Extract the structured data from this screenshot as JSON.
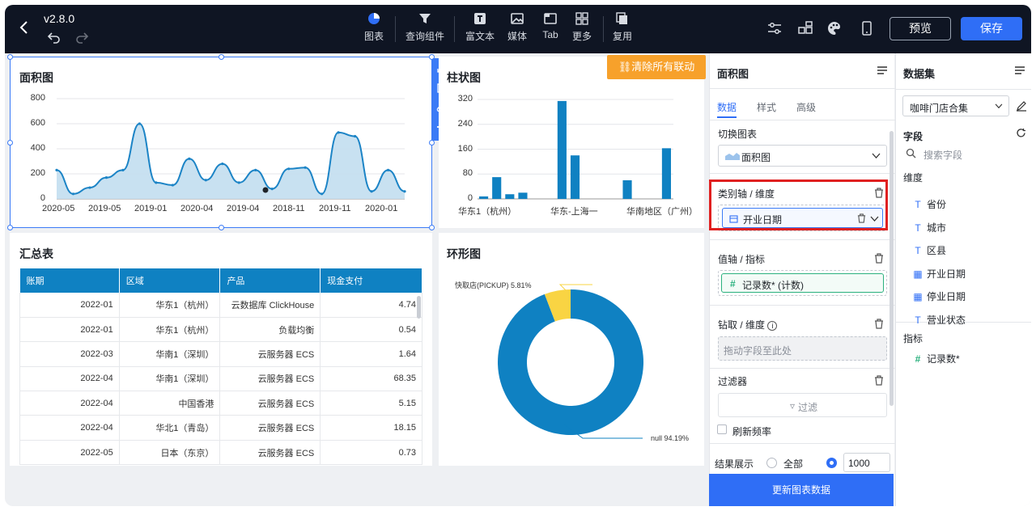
{
  "header": {
    "version": "v2.8.0",
    "tools": [
      {
        "label": "图表",
        "icon": "pie-chart-icon"
      },
      {
        "label": "查询组件",
        "icon": "filter-icon"
      },
      {
        "label": "富文本",
        "icon": "text-icon"
      },
      {
        "label": "媒体",
        "icon": "image-icon"
      },
      {
        "label": "Tab",
        "icon": "tab-icon"
      },
      {
        "label": "更多",
        "icon": "grid-icon"
      },
      {
        "label": "复用",
        "icon": "copy-icon"
      }
    ],
    "preview_label": "预览",
    "save_label": "保存"
  },
  "area_chart": {
    "title": "面积图",
    "chart_data": {
      "type": "area",
      "yticks": [
        "800",
        "600",
        "400",
        "200",
        "0"
      ],
      "xticks": [
        "2020-05",
        "2019-05",
        "2019-01",
        "2020-04",
        "2019-04",
        "2018-11",
        "2019-11",
        "2020-01"
      ],
      "ylim": [
        0,
        800
      ],
      "values": [
        230,
        40,
        90,
        170,
        230,
        600,
        130,
        110,
        320,
        150,
        280,
        130,
        230,
        80,
        240,
        250,
        40,
        530,
        500,
        60,
        230,
        60
      ],
      "color": "#1c84c6"
    }
  },
  "bar_chart": {
    "title": "柱状图",
    "chart_data": {
      "type": "bar",
      "yticks": [
        "320",
        "240",
        "160",
        "80",
        "0"
      ],
      "xticks": [
        "华东1（杭州）",
        "华东-上海一",
        "华南地区（广州）"
      ],
      "ylim": [
        0,
        320
      ],
      "values": [
        8,
        70,
        15,
        20,
        0,
        0,
        315,
        140,
        0,
        0,
        0,
        60,
        0,
        0,
        163
      ],
      "color": "#0f81c2"
    }
  },
  "clear_button_label": "清除所有联动",
  "table": {
    "title": "汇总表",
    "columns": [
      "账期",
      "区域",
      "产品",
      "现金支付"
    ],
    "rows": [
      [
        "2022-01",
        "华东1（杭州）",
        "云数据库 ClickHouse",
        "4.74"
      ],
      [
        "2022-01",
        "华东1（杭州）",
        "负载均衡",
        "0.54"
      ],
      [
        "2022-03",
        "华南1（深圳）",
        "云服务器 ECS",
        "1.64"
      ],
      [
        "2022-04",
        "华南1（深圳）",
        "云服务器 ECS",
        "68.35"
      ],
      [
        "2022-04",
        "中国香港",
        "云服务器 ECS",
        "5.15"
      ],
      [
        "2022-04",
        "华北1（青岛）",
        "云服务器 ECS",
        "18.15"
      ],
      [
        "2022-05",
        "日本（东京）",
        "云服务器 ECS",
        "0.73"
      ]
    ]
  },
  "donut_chart": {
    "title": "环形图",
    "chart_data": {
      "type": "pie",
      "slices": [
        {
          "label": "快取店(PICKUP) 5.81%",
          "value": 5.81,
          "color": "#f9d443"
        },
        {
          "label": "null 94.19%",
          "value": 94.19,
          "color": "#0f81c2"
        }
      ]
    }
  },
  "config": {
    "title": "面积图",
    "tabs": [
      "数据",
      "样式",
      "高级"
    ],
    "switch_chart_label": "切换图表",
    "chart_type_value": "面积图",
    "dimension_label": "类别轴 / 维度",
    "dimension_field": "开业日期",
    "metric_label": "值轴 / 指标",
    "metric_field": "记录数* (计数)",
    "drill_label": "钻取 / 维度",
    "drill_placeholder": "拖动字段至此处",
    "filter_label": "过滤器",
    "filter_button": "过滤",
    "refresh_label": "刷新频率",
    "result_label": "结果展示",
    "all_label": "全部",
    "limit_value": "1000",
    "update_button": "更新图表数据"
  },
  "dataset": {
    "title": "数据集",
    "dataset_value": "咖啡门店合集",
    "fields_label": "字段",
    "search_placeholder": "搜索字段",
    "dimension_label": "维度",
    "dimensions": [
      {
        "label": "省份",
        "type": "T"
      },
      {
        "label": "城市",
        "type": "T"
      },
      {
        "label": "区县",
        "type": "T"
      },
      {
        "label": "开业日期",
        "type": "date"
      },
      {
        "label": "停业日期",
        "type": "date"
      },
      {
        "label": "营业状态",
        "type": "T"
      }
    ],
    "metric_label": "指标",
    "metrics": [
      {
        "label": "记录数*",
        "type": "#"
      }
    ]
  }
}
